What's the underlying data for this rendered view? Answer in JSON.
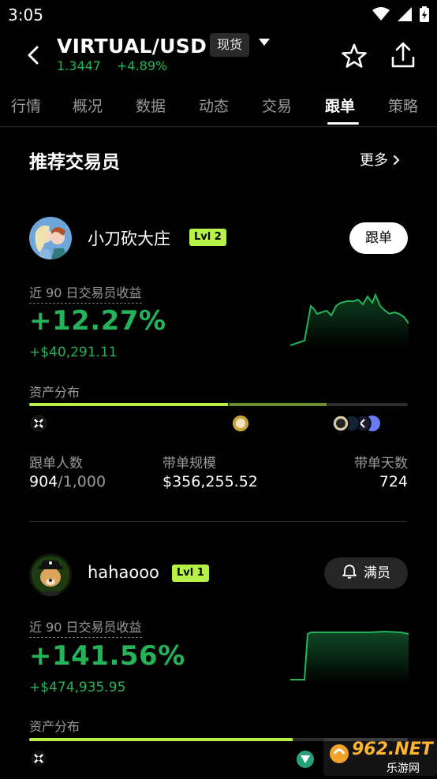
{
  "status": {
    "time": "3:05"
  },
  "header": {
    "pair": "VIRTUAL/USD",
    "market_type": "现货",
    "price": "1.3447",
    "change": "+4.89%"
  },
  "tabs": [
    "行情",
    "概况",
    "数据",
    "动态",
    "交易",
    "跟单",
    "策略"
  ],
  "active_tab": 5,
  "section": {
    "title": "推荐交易员",
    "more": "更多"
  },
  "traders": [
    {
      "name": "小刀砍大庄",
      "level": "Lvl 2",
      "action": "跟单",
      "roi_label": "近 90 日交易员收益",
      "roi": "+12.27%",
      "pnl": "+$40,291.11",
      "dist_label": "资产分布",
      "dist_segments": [
        0.53,
        0.26
      ],
      "stats": [
        {
          "label": "跟单人数",
          "value": "904",
          "value_suffix": "/1,000"
        },
        {
          "label": "带单规模",
          "value": "$356,255.52"
        },
        {
          "label": "带单天数",
          "value": "724"
        }
      ]
    },
    {
      "name": "hahaooo",
      "level": "Lvl 1",
      "action": "满员",
      "roi_label": "近 90 日交易员收益",
      "roi": "+141.56%",
      "pnl": "+$474,935.95",
      "dist_label": "资产分布",
      "dist_segments": [
        0.7
      ]
    }
  ],
  "colors": {
    "green": "#25b35a",
    "lime": "#b7f24a",
    "olive": "#6f8f2a"
  },
  "watermark": {
    "brand": "962.NET",
    "sub": "乐游网"
  }
}
